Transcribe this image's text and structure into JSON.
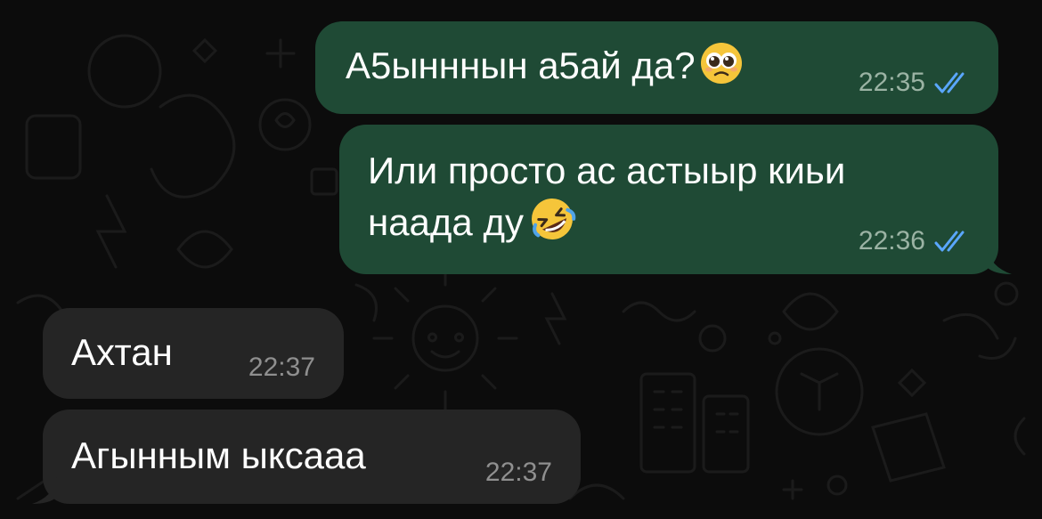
{
  "messages": [
    {
      "direction": "outgoing",
      "text": "А5ынннын а5ай да?",
      "emoji": "pleading-face",
      "time": "22:35",
      "status": "read"
    },
    {
      "direction": "outgoing",
      "text_line1": "Или просто ас астыыр киьи",
      "text_line2": "наада ду",
      "emoji": "rolling-on-floor-laughing",
      "time": "22:36",
      "status": "read"
    },
    {
      "direction": "incoming",
      "text": "Ахтан",
      "time": "22:37"
    },
    {
      "direction": "incoming",
      "text": "Агынным ыксааа",
      "time": "22:37"
    }
  ],
  "colors": {
    "background": "#0c0c0c",
    "outgoing_bubble": "#1f4a35",
    "incoming_bubble": "#252525",
    "read_checks": "#5aa7ff"
  }
}
